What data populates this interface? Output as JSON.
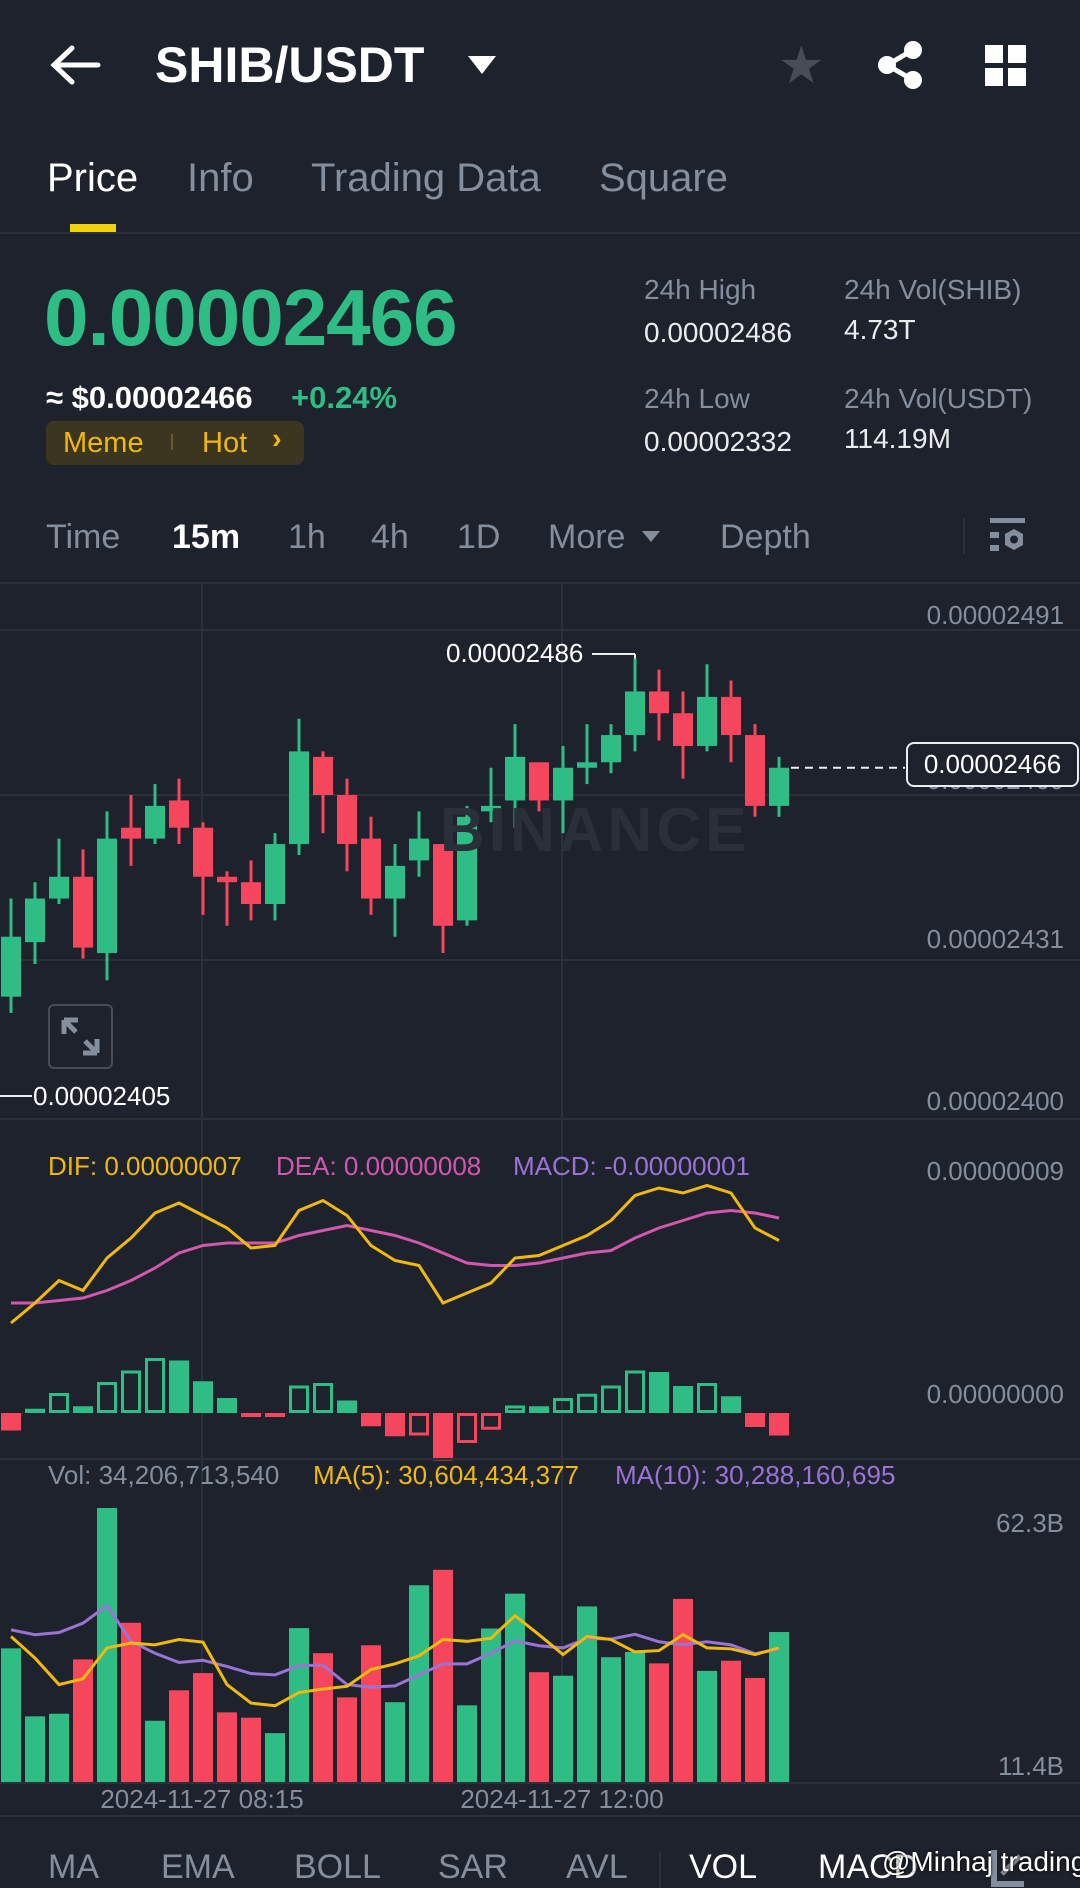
{
  "header": {
    "title": "SHIB/USDT",
    "icons": [
      "back-arrow-icon",
      "dropdown-caret-icon",
      "star-icon",
      "share-icon",
      "grid-icon"
    ]
  },
  "tabs": [
    {
      "label": "Price",
      "active": true
    },
    {
      "label": "Info"
    },
    {
      "label": "Trading Data"
    },
    {
      "label": "Square"
    }
  ],
  "ticker": {
    "price": "0.00002466",
    "usd_price": "≈ $0.00002466",
    "change": "+0.24%",
    "tags": [
      "Meme",
      "Hot"
    ],
    "tag_chevron": "›",
    "stats": [
      {
        "label": "24h High",
        "value": "0.00002486"
      },
      {
        "label": "24h Vol(SHIB)",
        "value": "4.73T"
      },
      {
        "label": "24h Low",
        "value": "0.00002332"
      },
      {
        "label": "24h Vol(USDT)",
        "value": "114.19M"
      }
    ]
  },
  "intervals": [
    {
      "label": "Time"
    },
    {
      "label": "15m",
      "active": true
    },
    {
      "label": "1h"
    },
    {
      "label": "4h"
    },
    {
      "label": "1D"
    },
    {
      "label": "More"
    },
    {
      "label": "Depth"
    }
  ],
  "colors": {
    "up": "#2ebd85",
    "down": "#f6465d",
    "accent": "#f0b90b",
    "dif": "#f0b90b",
    "dea": "#d257ae",
    "macd": "#9a73d6"
  },
  "chart_data": {
    "type": "candlestick",
    "value_scale": "1e-8",
    "price_axis_labels": [
      "0.00002491",
      "0.00002460",
      "0.00002431",
      "0.00002400"
    ],
    "current_price_label": "0.00002466",
    "high_marker": "0.00002486",
    "low_marker": "0.00002405",
    "watermark": "BINANCE",
    "x_labels": [
      "2024-11-27 08:15",
      "2024-11-27 12:00"
    ],
    "candles": [
      [
        2424,
        2442,
        2421,
        2435
      ],
      [
        2434,
        2445,
        2430,
        2442
      ],
      [
        2442,
        2453,
        2441,
        2446
      ],
      [
        2446,
        2451,
        2431,
        2433
      ],
      [
        2432,
        2458,
        2427,
        2453
      ],
      [
        2455,
        2461,
        2448,
        2453
      ],
      [
        2453,
        2463,
        2452,
        2459
      ],
      [
        2460,
        2464,
        2452,
        2455
      ],
      [
        2455,
        2456,
        2439,
        2446
      ],
      [
        2446,
        2447,
        2437,
        2445
      ],
      [
        2445,
        2449,
        2438,
        2441
      ],
      [
        2441,
        2454,
        2438,
        2452
      ],
      [
        2452,
        2475,
        2450,
        2469
      ],
      [
        2468,
        2469,
        2454,
        2461
      ],
      [
        2461,
        2464,
        2447,
        2452
      ],
      [
        2453,
        2457,
        2439,
        2442
      ],
      [
        2442,
        2452,
        2435,
        2448
      ],
      [
        2449,
        2458,
        2446,
        2453
      ],
      [
        2452,
        2452,
        2432,
        2437
      ],
      [
        2438,
        2459,
        2437,
        2457
      ],
      [
        2458,
        2466,
        2456,
        2459
      ],
      [
        2460,
        2474,
        2455,
        2468
      ],
      [
        2467,
        2467,
        2458,
        2460
      ],
      [
        2460,
        2470,
        2454,
        2466
      ],
      [
        2466,
        2474,
        2463,
        2467
      ],
      [
        2467,
        2474,
        2465,
        2472
      ],
      [
        2472,
        2486,
        2469,
        2480
      ],
      [
        2480,
        2484,
        2471,
        2476
      ],
      [
        2476,
        2480,
        2464,
        2470
      ],
      [
        2470,
        2485,
        2469,
        2479
      ],
      [
        2479,
        2482,
        2467,
        2472
      ],
      [
        2472,
        2474,
        2457,
        2459
      ],
      [
        2459,
        2468,
        2457,
        2466
      ]
    ],
    "macd": {
      "labels": {
        "dif": "DIF: 0.00000007",
        "dea": "DEA: 0.00000008",
        "macd": "MACD: -0.00000001"
      },
      "axis_labels": [
        "0.00000009",
        "0.00000000"
      ],
      "dif": [
        3.6,
        4.4,
        5.3,
        4.9,
        6.2,
        7.0,
        8.0,
        8.4,
        7.9,
        7.4,
        6.6,
        6.7,
        8.1,
        8.5,
        7.9,
        6.7,
        6.1,
        5.9,
        4.4,
        4.8,
        5.2,
        6.2,
        6.3,
        6.7,
        7.1,
        7.7,
        8.7,
        9.0,
        8.8,
        9.1,
        8.8,
        7.4,
        6.9
      ],
      "dea": [
        4.4,
        4.4,
        4.5,
        4.6,
        4.9,
        5.3,
        5.8,
        6.4,
        6.7,
        6.8,
        6.8,
        6.8,
        7.1,
        7.3,
        7.5,
        7.3,
        7.1,
        6.8,
        6.4,
        6.0,
        5.9,
        5.9,
        6.0,
        6.2,
        6.4,
        6.5,
        7.0,
        7.4,
        7.7,
        8.0,
        8.1,
        8.0,
        7.8
      ],
      "hist": [
        -0.7,
        0.17,
        0.8,
        0.27,
        1.24,
        1.7,
        2.2,
        2.1,
        1.27,
        0.6,
        -0.16,
        -0.13,
        1.1,
        1.2,
        0.5,
        -0.53,
        -0.93,
        -0.9,
        -1.9,
        -1.2,
        -0.67,
        0.3,
        0.27,
        0.6,
        0.77,
        1.1,
        1.7,
        1.64,
        1.08,
        1.2,
        0.67,
        -0.56,
        -0.9
      ]
    },
    "volume": {
      "unit": "B",
      "labels": {
        "vol": "Vol: 34,206,713,540",
        "ma5": "MA(5): 30,604,434,377",
        "ma10": "MA(10): 30,288,160,695"
      },
      "axis_labels": [
        "62.3B",
        "11.4B"
      ],
      "max": 62.3,
      "values": [
        30.5,
        15.1,
        15.7,
        28.0,
        62.3,
        36.3,
        14.1,
        21.0,
        24.9,
        16.0,
        14.8,
        11.3,
        35.1,
        29.4,
        19.4,
        31.2,
        18.3,
        44.8,
        48.3,
        17.6,
        35.0,
        42.9,
        25.1,
        24.3,
        40.0,
        28.5,
        29.7,
        27.1,
        41.7,
        25.4,
        27.7,
        23.8,
        34.2
      ],
      "ma5": [
        33.2,
        28.3,
        22.3,
        23.6,
        30.6,
        31.7,
        31.3,
        32.5,
        31.9,
        22.3,
        18.1,
        17.5,
        20.5,
        21.3,
        21.9,
        25.7,
        27.0,
        28.8,
        32.5,
        32.1,
        32.8,
        37.9,
        33.6,
        29.1,
        33.2,
        32.5,
        29.7,
        30.0,
        33.6,
        30.6,
        30.4,
        29.1,
        30.6
      ],
      "ma10": [
        34.7,
        33.6,
        34.1,
        36.2,
        40.2,
        32.1,
        29.4,
        27.3,
        27.8,
        26.4,
        24.8,
        24.5,
        26.6,
        26.7,
        22.3,
        21.7,
        22.0,
        24.5,
        27.0,
        27.0,
        29.4,
        32.2,
        31.1,
        30.6,
        32.8,
        32.6,
        33.7,
        32.0,
        31.3,
        32.0,
        31.3,
        29.3,
        30.3
      ]
    }
  },
  "bottom_tabs": [
    {
      "label": "MA"
    },
    {
      "label": "EMA"
    },
    {
      "label": "BOLL"
    },
    {
      "label": "SAR"
    },
    {
      "label": "AVL"
    },
    {
      "label": "VOL",
      "active": true
    },
    {
      "label": "MACD",
      "active": true
    }
  ],
  "overlay_watermark": "@Minhaj trading"
}
